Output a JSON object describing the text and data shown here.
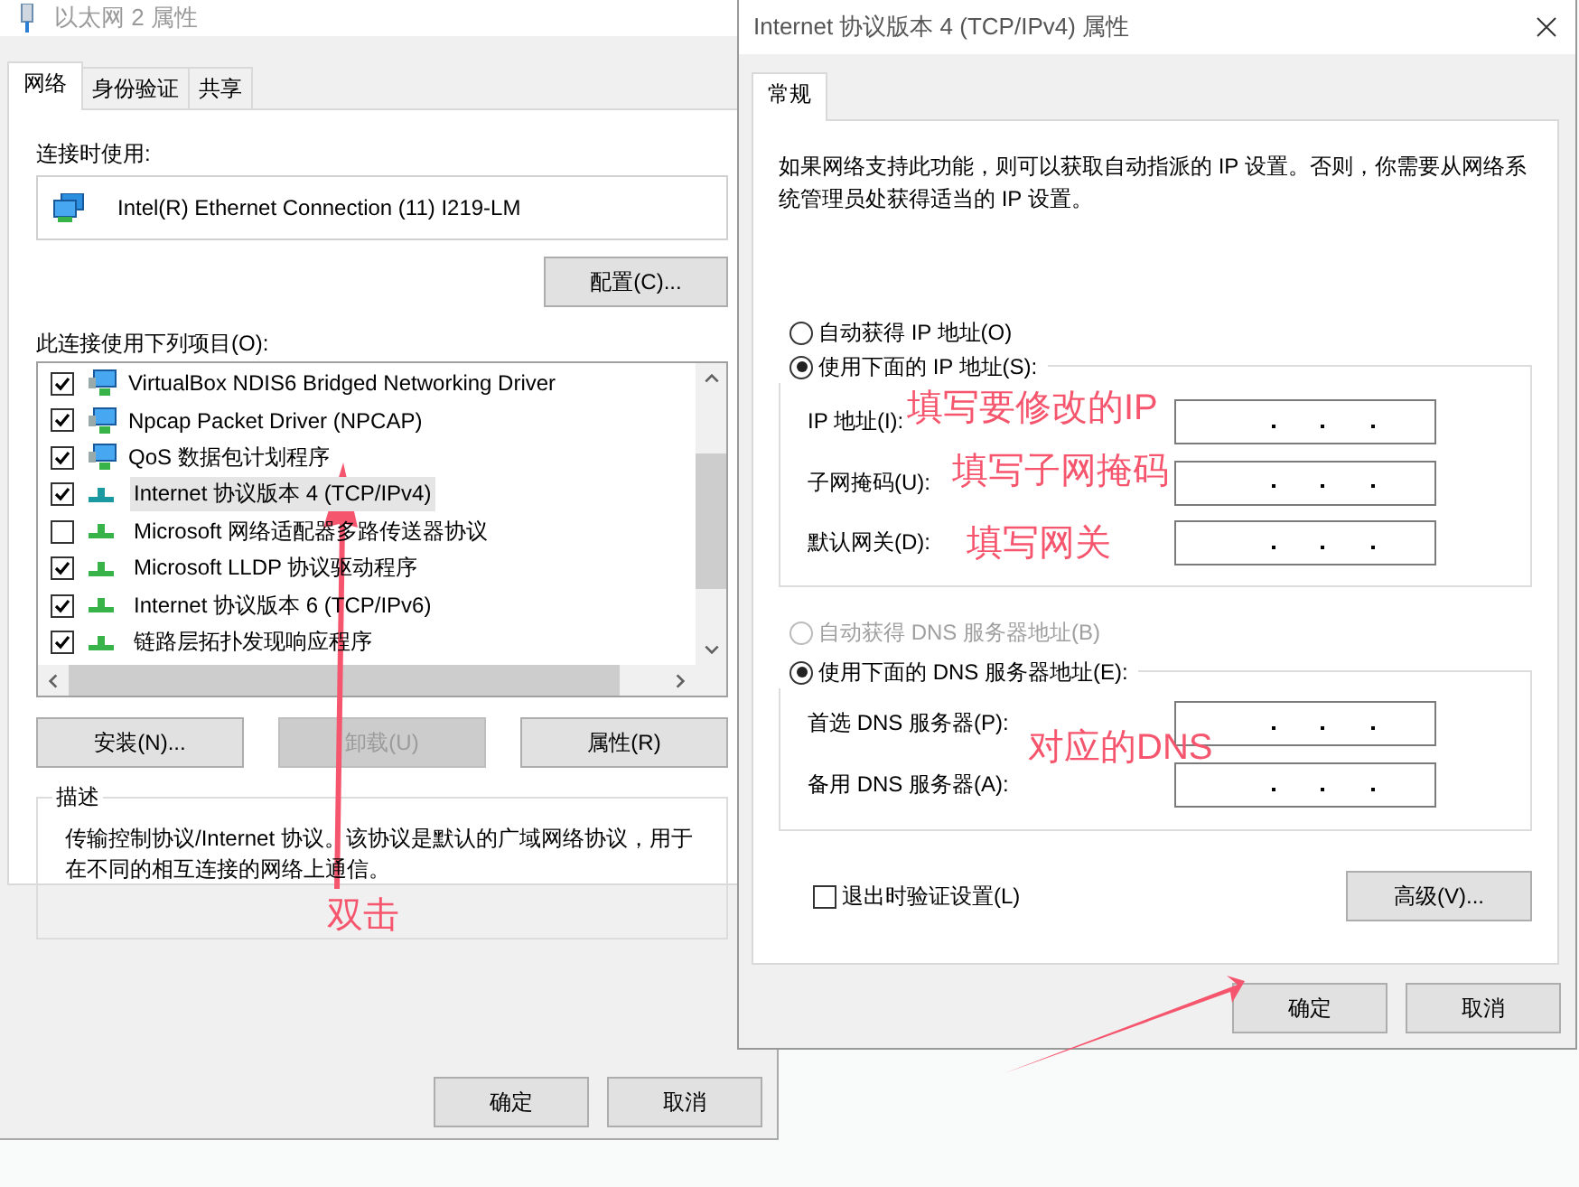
{
  "left_window": {
    "title": "以太网 2 属性",
    "tabs": [
      {
        "label": "网络",
        "selected": true
      },
      {
        "label": "身份验证",
        "selected": false
      },
      {
        "label": "共享",
        "selected": false
      }
    ],
    "connect_using_label": "连接时使用:",
    "adapter": "Intel(R) Ethernet Connection (11) I219-LM",
    "configure_button": "配置(C)...",
    "items_label": "此连接使用下列项目(O):",
    "items": [
      {
        "label": "VirtualBox NDIS6 Bridged Networking Driver",
        "checked": true,
        "kind": "computer",
        "selected": false
      },
      {
        "label": "Npcap Packet Driver (NPCAP)",
        "checked": true,
        "kind": "computer",
        "selected": false
      },
      {
        "label": "QoS 数据包计划程序",
        "checked": true,
        "kind": "computer",
        "selected": false
      },
      {
        "label": "Internet 协议版本 4 (TCP/IPv4)",
        "checked": true,
        "kind": "network",
        "selected": true
      },
      {
        "label": "Microsoft 网络适配器多路传送器协议",
        "checked": false,
        "kind": "network",
        "selected": false
      },
      {
        "label": "Microsoft LLDP 协议驱动程序",
        "checked": true,
        "kind": "network",
        "selected": false
      },
      {
        "label": "Internet 协议版本 6 (TCP/IPv6)",
        "checked": true,
        "kind": "network",
        "selected": false
      },
      {
        "label": "链路层拓扑发现响应程序",
        "checked": true,
        "kind": "network",
        "selected": false
      }
    ],
    "buttons": [
      {
        "label": "安装(N)...",
        "disabled": false
      },
      {
        "label": "卸载(U)",
        "disabled": true
      },
      {
        "label": "属性(R)",
        "disabled": false
      }
    ],
    "description_title": "描述",
    "description": "传输控制协议/Internet 协议。该协议是默认的广域网络协议，用于在不同的相互连接的网络上通信。",
    "dialog_buttons": [
      "确定",
      "取消"
    ]
  },
  "right_window": {
    "title": "Internet 协议版本 4 (TCP/IPv4) 属性",
    "tabs": [
      {
        "label": "常规",
        "selected": true
      }
    ],
    "intro": "如果网络支持此功能，则可以获取自动指派的 IP 设置。否则，你需要从网络系统管理员处获得适当的 IP 设置。",
    "ip_options": [
      {
        "label": "自动获得 IP 地址(O)",
        "selected": false,
        "disabled": false
      },
      {
        "label": "使用下面的 IP 地址(S):",
        "selected": true,
        "disabled": false
      }
    ],
    "ip_fields": [
      {
        "label": "IP 地址(I):"
      },
      {
        "label": "子网掩码(U):"
      },
      {
        "label": "默认网关(D):"
      }
    ],
    "dns_options": [
      {
        "label": "自动获得 DNS 服务器地址(B)",
        "selected": false,
        "disabled": true
      },
      {
        "label": "使用下面的 DNS 服务器地址(E):",
        "selected": true,
        "disabled": false
      }
    ],
    "dns_fields": [
      {
        "label": "首选 DNS 服务器(P):"
      },
      {
        "label": "备用 DNS 服务器(A):"
      }
    ],
    "validate_checkbox": {
      "label": "退出时验证设置(L)",
      "checked": false
    },
    "advanced_button": "高级(V)...",
    "dialog_buttons": [
      "确定",
      "取消"
    ]
  },
  "annotations": [
    {
      "text": "双击"
    },
    {
      "text": "填写要修改的IP"
    },
    {
      "text": "填写子网掩码"
    },
    {
      "text": "填写网关"
    },
    {
      "text": "对应的DNS"
    }
  ]
}
